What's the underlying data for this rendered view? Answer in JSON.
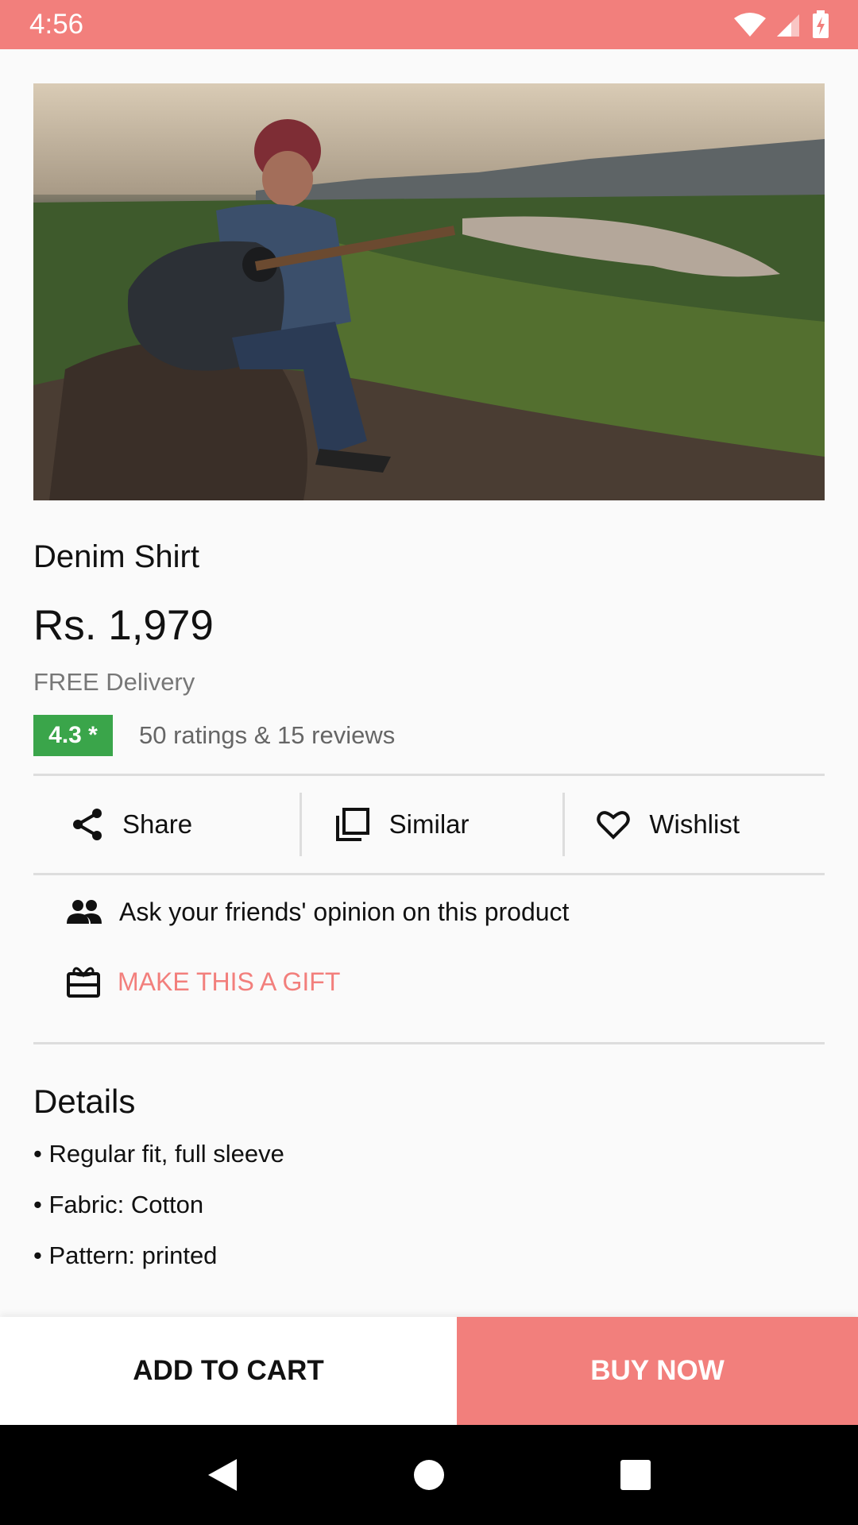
{
  "status_bar": {
    "time": "4:56"
  },
  "product": {
    "title": "Denim Shirt",
    "price": "Rs. 1,979",
    "delivery": "FREE Delivery",
    "rating": "4.3 *",
    "ratings_text": "50 ratings & 15 reviews"
  },
  "actions": {
    "share_label": "Share",
    "similar_label": "Similar",
    "wishlist_label": "Wishlist"
  },
  "extras": {
    "ask_friends_label": "Ask your friends' opinion on this product",
    "gift_label": "MAKE THIS A GIFT"
  },
  "details": {
    "title": "Details",
    "lines": [
      "• Regular fit, full sleeve",
      "• Fabric: Cotton",
      "• Pattern: printed"
    ]
  },
  "bottom_bar": {
    "add_to_cart_label": "ADD TO CART",
    "buy_now_label": "BUY NOW"
  },
  "colors": {
    "accent": "#f27f7c",
    "rating_green": "#3aa54a"
  }
}
